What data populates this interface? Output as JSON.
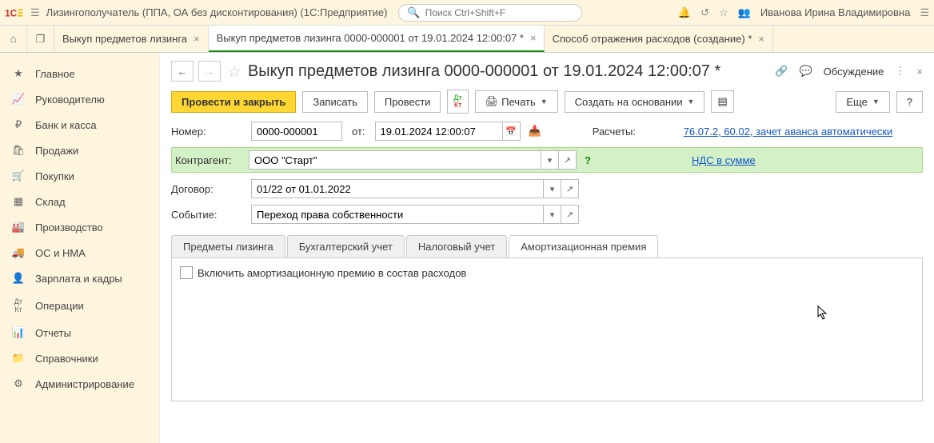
{
  "top": {
    "app_title": "Лизингополучатель (ППА, ОА без дисконтирования)  (1С:Предприятие)",
    "search_placeholder": "Поиск Ctrl+Shift+F",
    "user": "Иванова Ирина Владимировна"
  },
  "doc_tabs": [
    {
      "label": "Выкуп предметов лизинга"
    },
    {
      "label": "Выкуп предметов лизинга 0000-000001 от 19.01.2024 12:00:07 *"
    },
    {
      "label": "Способ отражения расходов (создание) *"
    }
  ],
  "sidebar": {
    "items": [
      "Главное",
      "Руководителю",
      "Банк и касса",
      "Продажи",
      "Покупки",
      "Склад",
      "Производство",
      "ОС и НМА",
      "Зарплата и кадры",
      "Операции",
      "Отчеты",
      "Справочники",
      "Администрирование"
    ]
  },
  "page": {
    "title": "Выкуп предметов лизинга 0000-000001 от 19.01.2024 12:00:07 *",
    "discuss": "Обсуждение"
  },
  "toolbar": {
    "post_close": "Провести и закрыть",
    "save": "Записать",
    "post": "Провести",
    "print": "Печать",
    "create_based": "Создать на основании",
    "more": "Еще",
    "help": "?"
  },
  "form": {
    "number_label": "Номер:",
    "number_value": "0000-000001",
    "from_label": "от:",
    "date_value": "19.01.2024 12:00:07",
    "calc_label": "Расчеты:",
    "calc_link": "76.07.2, 60.02, зачет аванса автоматически",
    "counterparty_label": "Контрагент:",
    "counterparty_value": "ООО \"Старт\"",
    "vat_link": "НДС в сумме",
    "contract_label": "Договор:",
    "contract_value": "01/22 от 01.01.2022",
    "event_label": "Событие:",
    "event_value": "Переход права собственности"
  },
  "inner_tabs": [
    "Предметы лизинга",
    "Бухгалтерский учет",
    "Налоговый учет",
    "Амортизационная премия"
  ],
  "tab_pane": {
    "checkbox_label": "Включить амортизационную премию в состав расходов"
  }
}
